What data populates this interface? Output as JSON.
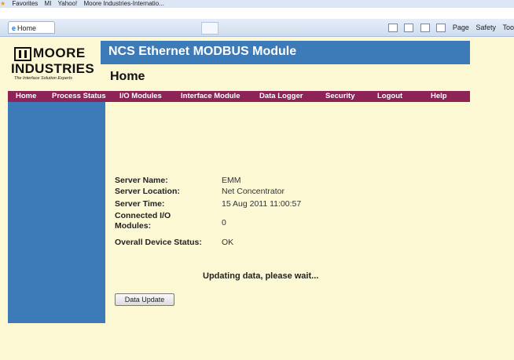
{
  "favorites_bar": {
    "favorites_label": "Favorites",
    "item_1": "MI",
    "item_2": "Yahoo!",
    "item_3": "Moore Industries-Internatio..."
  },
  "browser": {
    "tab_title": "Home",
    "page_menu": "Page",
    "safety_menu": "Safety",
    "tools_menu": "Too"
  },
  "logo": {
    "line1": "MOORE",
    "line2": "INDUSTRIES",
    "tagline": "The Interface Solution Experts"
  },
  "header": {
    "app_title": "NCS Ethernet MODBUS Module",
    "page_title": "Home"
  },
  "nav": [
    "Home",
    "Process Status",
    "I/O Modules",
    "Interface Module",
    "Data Logger",
    "Security",
    "Logout",
    "Help"
  ],
  "info": {
    "server_name_label": "Server Name:",
    "server_name_value": "EMM",
    "server_location_label": "Server Location:",
    "server_location_value": "Net Concentrator",
    "server_time_label": "Server Time:",
    "server_time_value": "15 Aug 2011 11:00:57",
    "connected_label_1": "Connected I/O",
    "connected_label_2": "Modules:",
    "connected_value": "0",
    "status_label": "Overall Device Status:",
    "status_value": "OK"
  },
  "status_message": "Updating data, please wait...",
  "update_button": "Data Update",
  "colors": {
    "page_bg": "#fcf8d3",
    "blue": "#3c7bb7",
    "nav_bg": "#8e2357"
  }
}
